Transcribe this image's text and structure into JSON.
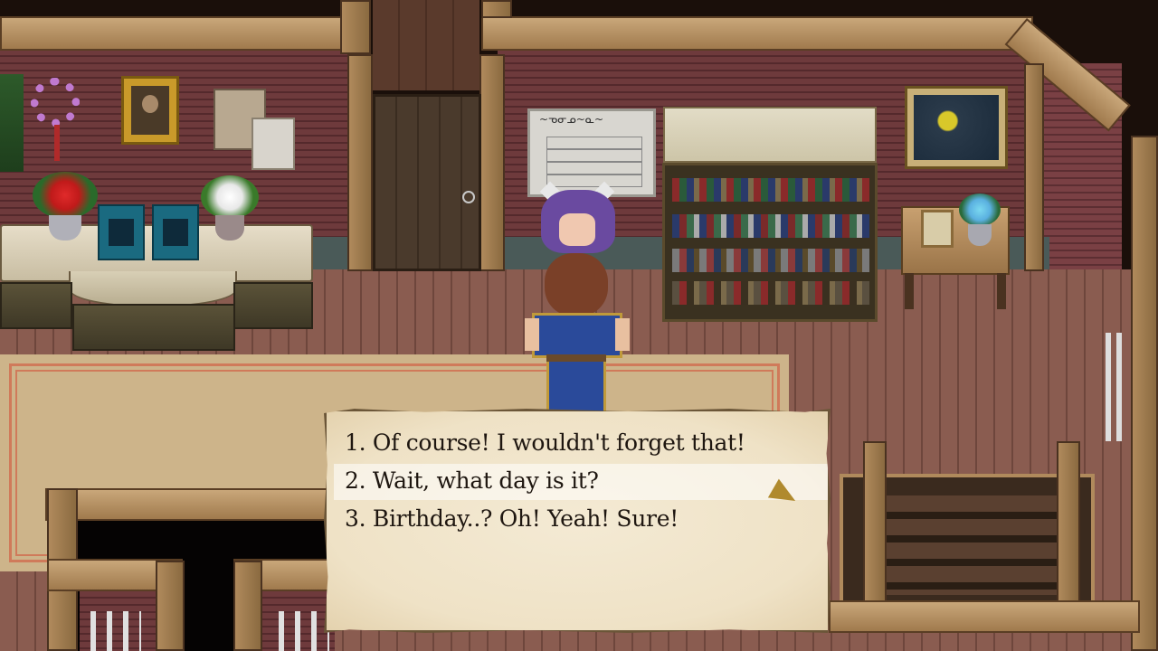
{
  "dialog": {
    "choices": [
      "1. Of course! I wouldn't forget that!",
      "2. Wait, what day is it?",
      "3. Birthday..? Oh! Yeah! Sure!"
    ],
    "selected_index": 1,
    "cursor_icon": "triangle-pointer-icon"
  },
  "scene": {
    "notice_text": "~ᓀᓂᓄ~ᓇ~",
    "colors": {
      "wall": "#6e3a3c",
      "floor": "#8a5c50",
      "parchment": "#efe2c6",
      "cursor": "#b08a2e"
    }
  }
}
